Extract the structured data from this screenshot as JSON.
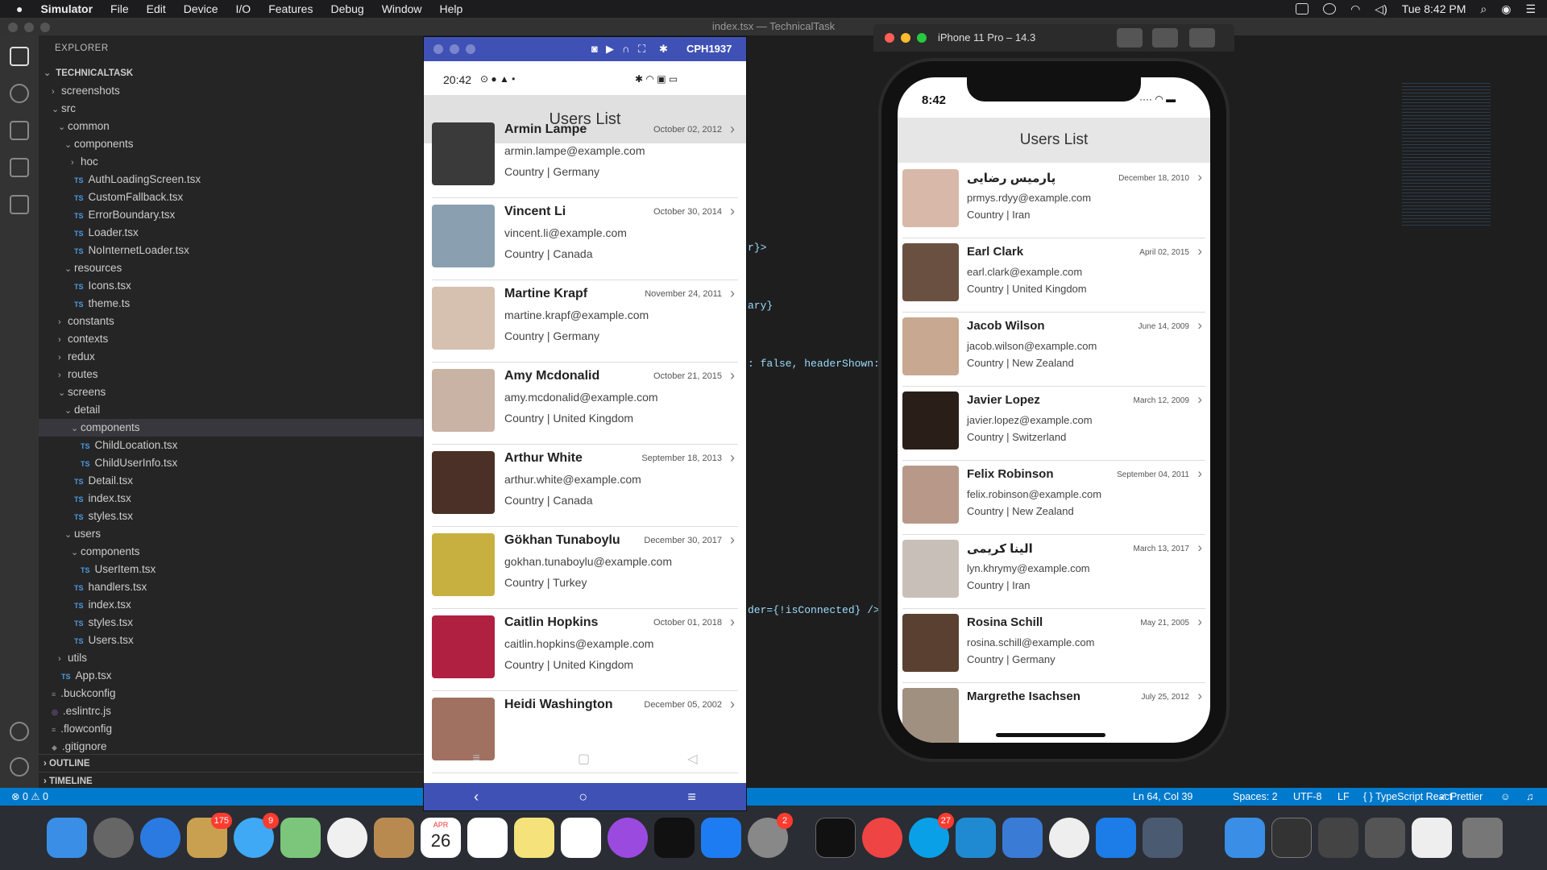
{
  "menubar": {
    "app": "Simulator",
    "items": [
      "File",
      "Edit",
      "Device",
      "I/O",
      "Features",
      "Debug",
      "Window",
      "Help"
    ],
    "clock": "Tue 8:42 PM"
  },
  "vscode": {
    "title": "index.tsx — TechnicalTask",
    "explorer_label": "EXPLORER",
    "project": "TECHNICALTASK",
    "tree": [
      {
        "label": "screenshots",
        "depth": 1,
        "kind": "folder",
        "open": false
      },
      {
        "label": "src",
        "depth": 1,
        "kind": "folder",
        "open": true
      },
      {
        "label": "common",
        "depth": 2,
        "kind": "folder",
        "open": true
      },
      {
        "label": "components",
        "depth": 3,
        "kind": "folder",
        "open": true
      },
      {
        "label": "hoc",
        "depth": 4,
        "kind": "folder",
        "open": false
      },
      {
        "label": "AuthLoadingScreen.tsx",
        "depth": 4,
        "kind": "ts"
      },
      {
        "label": "CustomFallback.tsx",
        "depth": 4,
        "kind": "ts"
      },
      {
        "label": "ErrorBoundary.tsx",
        "depth": 4,
        "kind": "ts"
      },
      {
        "label": "Loader.tsx",
        "depth": 4,
        "kind": "ts"
      },
      {
        "label": "NoInternetLoader.tsx",
        "depth": 4,
        "kind": "ts"
      },
      {
        "label": "resources",
        "depth": 3,
        "kind": "folder",
        "open": true
      },
      {
        "label": "Icons.tsx",
        "depth": 4,
        "kind": "ts"
      },
      {
        "label": "theme.ts",
        "depth": 4,
        "kind": "ts"
      },
      {
        "label": "constants",
        "depth": 2,
        "kind": "folder",
        "open": false
      },
      {
        "label": "contexts",
        "depth": 2,
        "kind": "folder",
        "open": false
      },
      {
        "label": "redux",
        "depth": 2,
        "kind": "folder",
        "open": false
      },
      {
        "label": "routes",
        "depth": 2,
        "kind": "folder",
        "open": false
      },
      {
        "label": "screens",
        "depth": 2,
        "kind": "folder",
        "open": true
      },
      {
        "label": "detail",
        "depth": 3,
        "kind": "folder",
        "open": true
      },
      {
        "label": "components",
        "depth": 4,
        "kind": "folder",
        "open": true,
        "selected": true
      },
      {
        "label": "ChildLocation.tsx",
        "depth": 5,
        "kind": "ts"
      },
      {
        "label": "ChildUserInfo.tsx",
        "depth": 5,
        "kind": "ts"
      },
      {
        "label": "Detail.tsx",
        "depth": 4,
        "kind": "ts"
      },
      {
        "label": "index.tsx",
        "depth": 4,
        "kind": "ts"
      },
      {
        "label": "styles.tsx",
        "depth": 4,
        "kind": "ts"
      },
      {
        "label": "users",
        "depth": 3,
        "kind": "folder",
        "open": true
      },
      {
        "label": "components",
        "depth": 4,
        "kind": "folder",
        "open": true
      },
      {
        "label": "UserItem.tsx",
        "depth": 5,
        "kind": "ts"
      },
      {
        "label": "handlers.tsx",
        "depth": 4,
        "kind": "ts"
      },
      {
        "label": "index.tsx",
        "depth": 4,
        "kind": "ts"
      },
      {
        "label": "styles.tsx",
        "depth": 4,
        "kind": "ts"
      },
      {
        "label": "Users.tsx",
        "depth": 4,
        "kind": "ts"
      },
      {
        "label": "utils",
        "depth": 2,
        "kind": "folder",
        "open": false
      },
      {
        "label": "App.tsx",
        "depth": 2,
        "kind": "ts"
      },
      {
        "label": ".buckconfig",
        "depth": 1,
        "kind": "file"
      },
      {
        "label": ".eslintrc.js",
        "depth": 1,
        "kind": "eslint"
      },
      {
        "label": ".flowconfig",
        "depth": 1,
        "kind": "file"
      },
      {
        "label": ".gitignore",
        "depth": 1,
        "kind": "git"
      }
    ],
    "outline_label": "OUTLINE",
    "timeline_label": "TIMELINE",
    "code_fragments": [
      "r}>",
      "ary}",
      ": false, headerShown: fa",
      "der={!isConnected} />}"
    ],
    "status": {
      "problems": "⊗ 0 ⚠ 0",
      "position": "Ln 64, Col 39",
      "spaces": "Spaces: 2",
      "encoding": "UTF-8",
      "eol": "LF",
      "language": "{ } TypeScript React",
      "prettier": "✓ Prettier"
    }
  },
  "android": {
    "device": "CPH1937",
    "time": "20:42",
    "header": "Users List",
    "users": [
      {
        "name": "Armin Lampe",
        "email": "armin.lampe@example.com",
        "country": "Country | Germany",
        "date": "October 02, 2012",
        "color": "#3a3a3a"
      },
      {
        "name": "Vincent Li",
        "email": "vincent.li@example.com",
        "country": "Country | Canada",
        "date": "October 30, 2014",
        "color": "#8aa0b0"
      },
      {
        "name": "Martine Krapf",
        "email": "martine.krapf@example.com",
        "country": "Country | Germany",
        "date": "November 24, 2011",
        "color": "#d6c0b0"
      },
      {
        "name": "Amy Mcdonalid",
        "email": "amy.mcdonalid@example.com",
        "country": "Country | United Kingdom",
        "date": "October 21, 2015",
        "color": "#c9b3a5"
      },
      {
        "name": "Arthur White",
        "email": "arthur.white@example.com",
        "country": "Country | Canada",
        "date": "September 18, 2013",
        "color": "#4a3026"
      },
      {
        "name": "Gökhan Tunaboylu",
        "email": "gokhan.tunaboylu@example.com",
        "country": "Country | Turkey",
        "date": "December 30, 2017",
        "color": "#c8b040"
      },
      {
        "name": "Caitlin Hopkins",
        "email": "caitlin.hopkins@example.com",
        "country": "Country | United Kingdom",
        "date": "October 01, 2018",
        "color": "#b02040"
      },
      {
        "name": "Heidi Washington",
        "email": "",
        "country": "",
        "date": "December 05, 2002",
        "color": "#a07060"
      }
    ]
  },
  "ios": {
    "window_title": "iPhone 11 Pro – 14.3",
    "time": "8:42",
    "header": "Users List",
    "users": [
      {
        "name": "پارمیس رضایی",
        "email": "prmys.rdyy@example.com",
        "country": "Country | Iran",
        "date": "December 18, 2010",
        "color": "#d8b8a8"
      },
      {
        "name": "Earl Clark",
        "email": "earl.clark@example.com",
        "country": "Country | United Kingdom",
        "date": "April 02, 2015",
        "color": "#6a5040"
      },
      {
        "name": "Jacob Wilson",
        "email": "jacob.wilson@example.com",
        "country": "Country | New Zealand",
        "date": "June 14, 2009",
        "color": "#c8a890"
      },
      {
        "name": "Javier Lopez",
        "email": "javier.lopez@example.com",
        "country": "Country | Switzerland",
        "date": "March 12, 2009",
        "color": "#2a1e18"
      },
      {
        "name": "Felix Robinson",
        "email": "felix.robinson@example.com",
        "country": "Country | New Zealand",
        "date": "September 04, 2011",
        "color": "#b89888"
      },
      {
        "name": "الینا کریمی",
        "email": "lyn.khrymy@example.com",
        "country": "Country | Iran",
        "date": "March 13, 2017",
        "color": "#c8c0b8"
      },
      {
        "name": "Rosina Schill",
        "email": "rosina.schill@example.com",
        "country": "Country | Germany",
        "date": "May 21, 2005",
        "color": "#5a4030"
      },
      {
        "name": "Margrethe Isachsen",
        "email": "",
        "country": "",
        "date": "July 25, 2012",
        "color": "#a09080"
      }
    ]
  },
  "dock": {
    "badges": {
      "mail": "175",
      "messages": "9",
      "settings": "2",
      "skype": "27"
    },
    "calendar_month": "APR",
    "calendar_day": "26"
  }
}
